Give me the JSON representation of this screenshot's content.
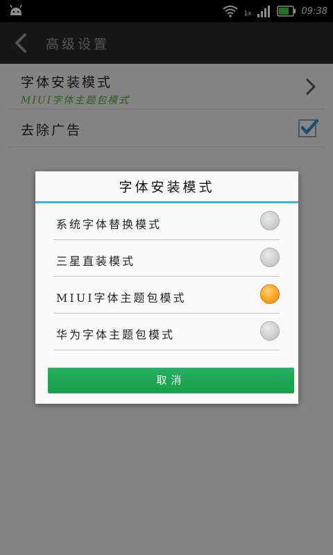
{
  "status_bar": {
    "time": "09:38",
    "network_label": "1x",
    "icons": [
      "android-icon",
      "wifi-icon",
      "signal-icon",
      "battery-icon"
    ]
  },
  "action_bar": {
    "title": "高级设置",
    "back_icon": "chevron-left-icon"
  },
  "settings": {
    "font_mode": {
      "title": "字体安装模式",
      "subtitle": "MIUI字体主题包模式",
      "icon": "chevron-right-icon"
    },
    "remove_ads": {
      "title": "去除广告",
      "checked": true
    }
  },
  "dialog": {
    "title": "字体安装模式",
    "options": [
      {
        "label": "系统字体替换模式",
        "checked": false
      },
      {
        "label": "三星直装模式",
        "checked": false
      },
      {
        "label": "MIUI字体主题包模式",
        "checked": true
      },
      {
        "label": "华为字体主题包模式",
        "checked": false
      }
    ],
    "cancel_label": "取消"
  },
  "colors": {
    "accent_blue": "#33b5e5",
    "selected_orange": "#ffa41e",
    "button_green": "#1fa854",
    "subtitle_green": "#58a632",
    "checkbox_blue": "#2a8fd0"
  }
}
